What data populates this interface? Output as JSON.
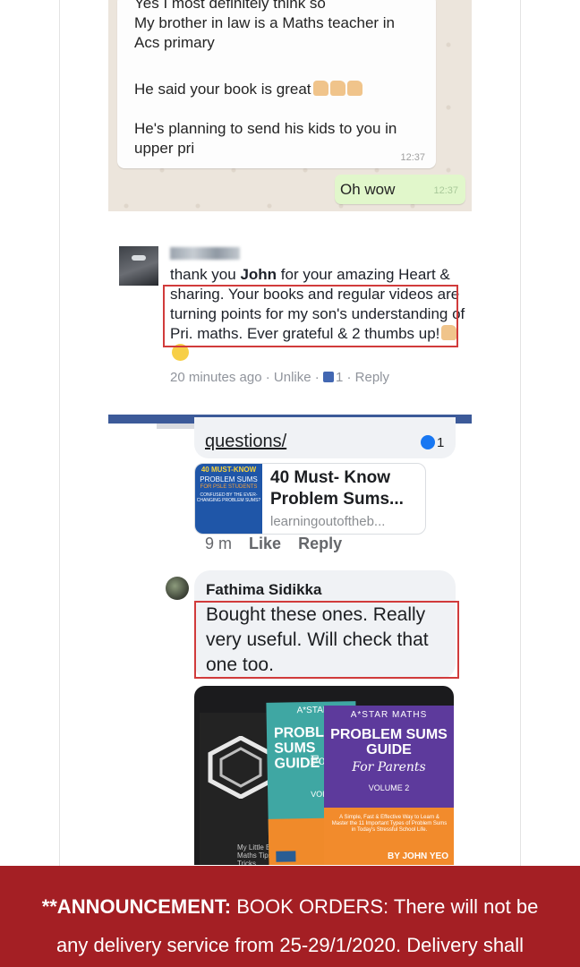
{
  "whatsapp": {
    "incoming_lines": [
      "Yes I most definitely think so",
      "My brother in law is a Maths teacher in",
      "Acs primary",
      "He said your book is great",
      "He's planning to send his kids to you in",
      "upper pri"
    ],
    "incoming_time": "12:37",
    "outgoing_text": "Oh wow",
    "outgoing_time": "12:37"
  },
  "comment1": {
    "text_prefix": "thank you ",
    "mention": "John",
    "text_rest": " for your amazing Heart & sharing. Your books and regular videos are turning points for my son's understanding of Pri. maths.  Ever grateful & 2 thumbs up!",
    "time": "20 minutes ago",
    "unlike": "Unlike",
    "like_count": "1",
    "reply": "Reply"
  },
  "thread": {
    "link_text": "questions/",
    "reaction_count": "1",
    "preview": {
      "title": "40 Must- Know Problem Sums...",
      "domain": "learningoutoftheb...",
      "thumb_line1": "40 MUST-KNOW",
      "thumb_line2": "PROBLEM SUMS",
      "thumb_line3": "FOR PSLE STUDENTS",
      "thumb_line4": "CONFUSED BY THE EVER-CHANGING PROBLEM SUMS?"
    },
    "time": "9 m",
    "like": "Like",
    "reply": "Reply"
  },
  "comment2": {
    "name": "Fathima Sidikka",
    "text": "Bought these ones. Really very useful. Will check that one too."
  },
  "photo": {
    "black_book_text": "My Little Book of Maths Tips & Tricks",
    "teal_book_brand": "A*STAR",
    "teal_book_title": "PROBLEM SUMS GUIDE",
    "teal_book_sub": "For",
    "teal_book_vol": "VOL",
    "purple_book_brand": "A*STAR MATHS",
    "purple_book_title": "PROBLEM SUMS GUIDE",
    "purple_book_sub": "For Parents",
    "purple_book_vol": "VOLUME 2",
    "purple_book_note": "A Simple, Fast & Effective Way to Learn & Master the 11 Important Types of Problem Sums in Today's Stressful School Life.",
    "purple_book_author": "BY JOHN YEO"
  },
  "banner": {
    "label": "**ANNOUNCEMENT:",
    "line1_rest": " BOOK ORDERS: There will not be",
    "line2": "any delivery service from 25-29/1/2020. Delivery shall"
  }
}
